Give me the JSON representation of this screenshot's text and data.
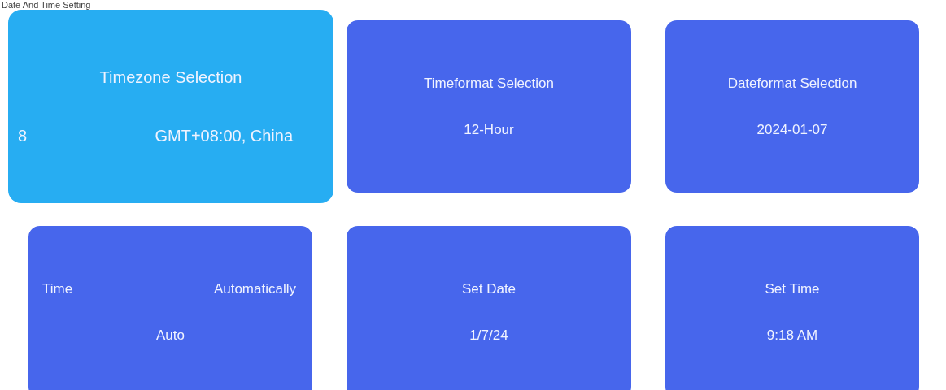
{
  "header": {
    "title": "Date And Time Setting"
  },
  "cards": [
    {
      "title": [
        "Timezone Selection"
      ],
      "value": [
        "8",
        "GMT+08:00, China"
      ],
      "selected": true
    },
    {
      "title": [
        "Timeformat Selection"
      ],
      "value": [
        "12-Hour"
      ],
      "selected": false
    },
    {
      "title": [
        "Dateformat Selection"
      ],
      "value": [
        "2024-01-07"
      ],
      "selected": false
    },
    {
      "title": [
        "Time",
        "Automatically"
      ],
      "value": [
        "Auto"
      ],
      "selected": false
    },
    {
      "title": [
        "Set Date"
      ],
      "value": [
        "1/7/24"
      ],
      "selected": false
    },
    {
      "title": [
        "Set Time"
      ],
      "value": [
        "9:18 AM"
      ],
      "selected": false
    }
  ]
}
